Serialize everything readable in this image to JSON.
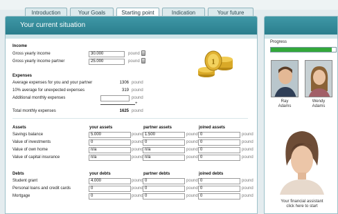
{
  "tabs": [
    "Introduction",
    "Your Goals",
    "Starting point",
    "Indication",
    "Your future"
  ],
  "active_tab": 2,
  "panel_title": "Your current situation",
  "income": {
    "heading": "Income",
    "rows": [
      {
        "label": "Gross yearly income",
        "value": "30.000",
        "unit": "pound"
      },
      {
        "label": "Gross yearly income partner",
        "value": "25.000",
        "unit": "pound"
      }
    ]
  },
  "expenses": {
    "heading": "Expenses",
    "rows": [
      {
        "label": "Average expenses for you and your partner",
        "value": "1306",
        "unit": "pound"
      },
      {
        "label": "10% average for unexpected expenses",
        "value": "319",
        "unit": "pound"
      },
      {
        "label": "Additional monthly expenses",
        "value": "",
        "unit": "pound"
      }
    ],
    "plus": "+",
    "total_label": "Total monthly expenses",
    "total_value": "1625",
    "total_unit": "pound"
  },
  "assets": {
    "heading": "Assets",
    "columns": [
      "your assets",
      "partner assets",
      "joined assets"
    ],
    "unit": "pound",
    "rows": [
      {
        "label": "Savings balance",
        "values": [
          "5.000",
          "1.500",
          "0"
        ]
      },
      {
        "label": "Value of investments",
        "values": [
          "0",
          "0",
          "0"
        ]
      },
      {
        "label": "Value of own home",
        "values": [
          "n/a",
          "n/a",
          "0"
        ]
      },
      {
        "label": "Value of capital insurance",
        "values": [
          "n/a",
          "n/a",
          "0"
        ]
      }
    ]
  },
  "debts": {
    "heading": "Debts",
    "columns": [
      "your debts",
      "partner debts",
      "joined debts"
    ],
    "unit": "pound",
    "rows": [
      {
        "label": "Student grant",
        "values": [
          "4.000",
          "0",
          "0"
        ]
      },
      {
        "label": "Personal loans and credit cards",
        "values": [
          "0",
          "0",
          "0"
        ]
      },
      {
        "label": "Mortgage",
        "values": [
          "0",
          "0",
          "0"
        ]
      }
    ]
  },
  "sidebar": {
    "progress_label": "Progress",
    "progress_fraction": 0.94,
    "people": [
      {
        "name_first": "Ray",
        "name_last": "Adams"
      },
      {
        "name_first": "Wendy",
        "name_last": "Adams"
      }
    ],
    "assistant_line1": "Your financial assistant",
    "assistant_line2": "click here to start"
  },
  "colors": {
    "header": "#2e8696",
    "progress": "#33a83a",
    "accent_light": "#cfe5e9"
  }
}
